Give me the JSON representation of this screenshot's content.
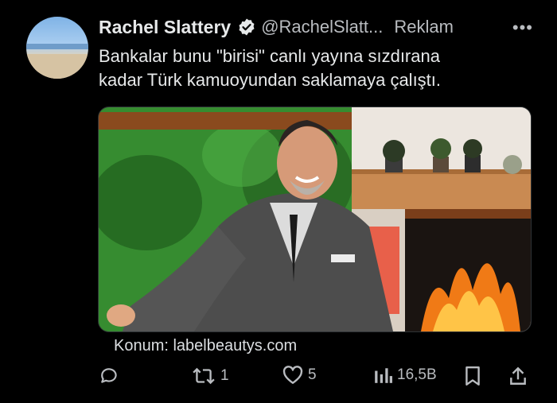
{
  "post": {
    "author_name": "Rachel Slattery",
    "handle": "@RachelSlatt...",
    "ad_label": "Reklam",
    "more_label": "•••",
    "text_lines": [
      "Bankalar bunu \"birisi\" canlı yayına sızdırana",
      "kadar Türk kamuoyundan saklamaya çalıştı."
    ],
    "location": "Konum: labelbeautys.com"
  },
  "actions": {
    "reposts": "1",
    "likes": "5",
    "views": "16,5B"
  },
  "icons": {
    "verified": "verified-badge-icon",
    "reply": "reply-icon",
    "repost": "repost-icon",
    "like": "heart-icon",
    "views": "views-chart-icon",
    "bookmark": "bookmark-icon",
    "share": "share-icon"
  },
  "colors": {
    "background": "#000000",
    "text": "#e7e9ea",
    "secondary": "#b9bcc0",
    "verified": "#1d9bf0"
  }
}
